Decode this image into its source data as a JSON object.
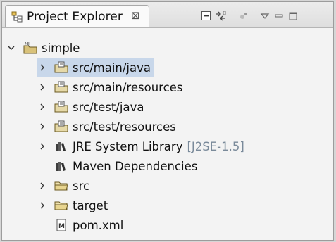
{
  "view": {
    "title": "Project Explorer",
    "close_glyph": "⊠",
    "toolbar": [
      "collapse-all-icon",
      "link-with-editor-icon",
      "new-icon",
      "view-menu-icon",
      "minimize-icon",
      "maximize-icon"
    ]
  },
  "tree": {
    "project": {
      "label": "simple",
      "icon": "maven-project-icon",
      "expanded": true
    },
    "children": [
      {
        "label": "src/main/java",
        "icon": "source-folder-icon",
        "expandable": true
      },
      {
        "label": "src/main/resources",
        "icon": "source-folder-icon",
        "expandable": true
      },
      {
        "label": "src/test/java",
        "icon": "source-folder-icon",
        "expandable": true
      },
      {
        "label": "src/test/resources",
        "icon": "source-folder-icon",
        "expandable": true
      },
      {
        "label": "JRE System Library",
        "decoration": "[J2SE-1.5]",
        "icon": "library-icon",
        "expandable": true
      },
      {
        "label": "Maven Dependencies",
        "icon": "library-icon",
        "expandable": false
      },
      {
        "label": "src",
        "icon": "folder-icon",
        "expandable": true
      },
      {
        "label": "target",
        "icon": "folder-icon",
        "expandable": true
      },
      {
        "label": "pom.xml",
        "icon": "maven-pom-file-icon",
        "expandable": false
      }
    ]
  },
  "colors": {
    "selection": "#c8d7ea",
    "decoration": "#7a8a9a"
  }
}
